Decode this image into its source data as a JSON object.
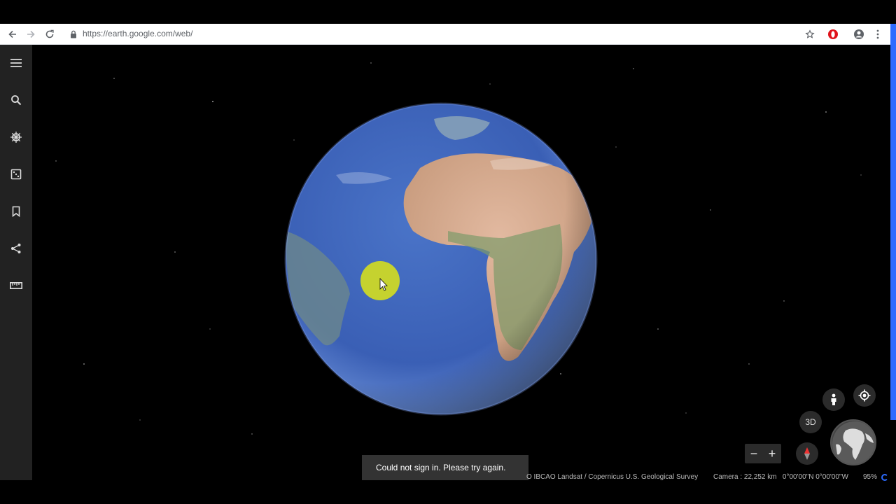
{
  "browser": {
    "url": "https://earth.google.com/web/",
    "icons": [
      "back-icon",
      "forward-icon",
      "reload-icon",
      "lock-icon",
      "star-icon",
      "opera-icon",
      "account-icon",
      "kebab-menu-icon"
    ]
  },
  "rail": {
    "items": [
      {
        "name": "menu",
        "icon": "hamburger-icon"
      },
      {
        "name": "search",
        "icon": "search-icon"
      },
      {
        "name": "voyager",
        "icon": "voyager-wheel-icon"
      },
      {
        "name": "feeling-lucky",
        "icon": "dice-icon"
      },
      {
        "name": "projects",
        "icon": "bookmark-icon"
      },
      {
        "name": "share",
        "icon": "share-icon"
      },
      {
        "name": "measure",
        "icon": "ruler-icon"
      }
    ]
  },
  "controls": {
    "view_3d_label": "3D",
    "zoom_out": "−",
    "zoom_in": "+"
  },
  "toast": {
    "message": "Could not sign in. Please try again."
  },
  "status": {
    "attribution": "O IBCAO Landsat / Copernicus U.S. Geological Survey",
    "camera": "Camera : 22,252 km   0°00'00\"N 0°00'00\"W",
    "loading_pct": "95%"
  },
  "colors": {
    "ocean": "#3f63b8",
    "land": "#c9a78a",
    "cursor_highlight": "#d4de1f",
    "rail_bg": "#222222",
    "opera_red": "#e0131b"
  }
}
